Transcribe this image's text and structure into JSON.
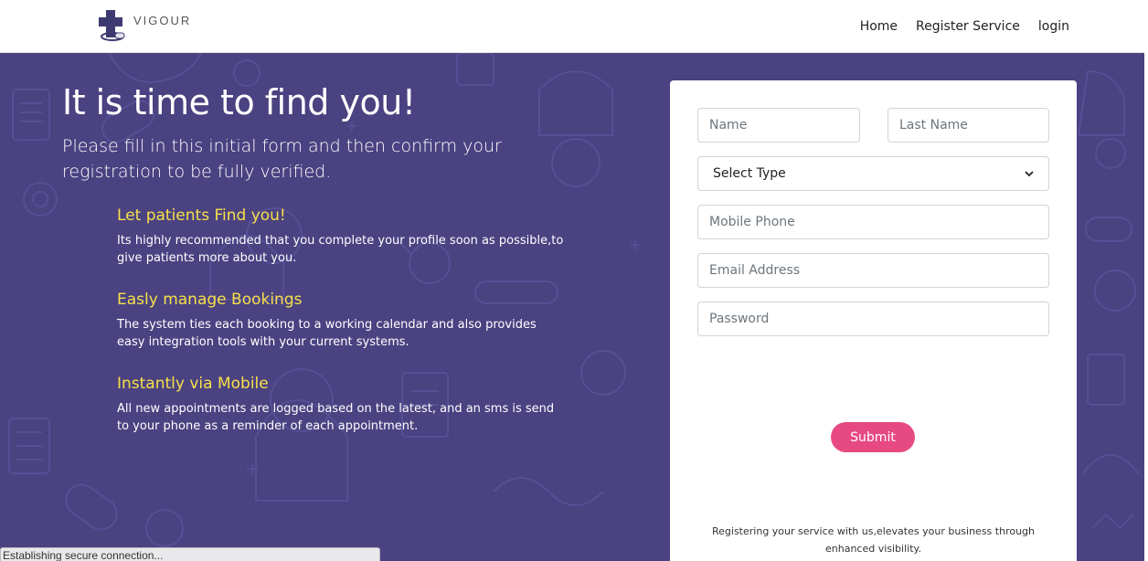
{
  "brand": {
    "name": "VIGOUR"
  },
  "nav": {
    "home": "Home",
    "register_service": "Register Service",
    "login": "login"
  },
  "hero": {
    "title": "It is time to find you!",
    "subtitle": "Please fill in this initial form and then confirm your registration to be fully verified."
  },
  "features": [
    {
      "title": "Let patients Find you!",
      "text": "Its highly recommended that you complete your profile soon as possible,to give patients more about you."
    },
    {
      "title": "Easly manage Bookings",
      "text": "The system ties each booking to a working calendar and also provides easy integration tools with your current systems."
    },
    {
      "title": "Instantly via Mobile",
      "text": "All new appointments are logged based on the latest, and an sms is send to your phone as a reminder of each appointment."
    }
  ],
  "form": {
    "name_placeholder": "Name",
    "last_name_placeholder": "Last Name",
    "type_selected": "Select Type",
    "mobile_placeholder": "Mobile Phone",
    "email_placeholder": "Email Address",
    "password_placeholder": "Password",
    "submit_label": "Submit",
    "footer_note": "Registering your service with us,elevates your business through enhanced visibility."
  },
  "status": {
    "text": "Establishing secure connection..."
  },
  "colors": {
    "hero_bg": "#4a4281",
    "accent_yellow": "#f7e04a",
    "submit_pink": "#e74a82"
  }
}
